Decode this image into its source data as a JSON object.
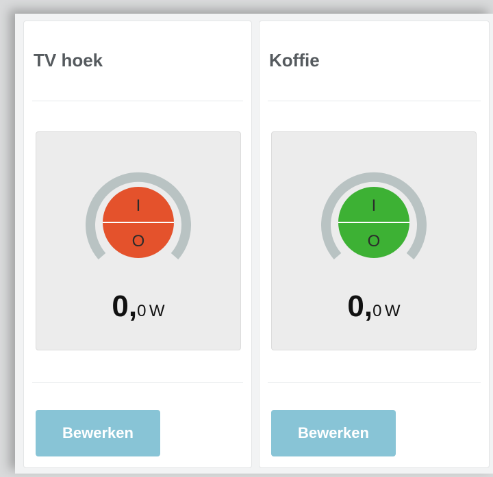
{
  "devices": [
    {
      "name": "TV hoek",
      "state_color": "#e4522c",
      "switch_on_symbol": "I",
      "switch_off_symbol": "O",
      "power_integer": "0,",
      "power_decimal": "0",
      "power_unit": "W",
      "edit_label": "Bewerken"
    },
    {
      "name": "Koffie",
      "state_color": "#3db134",
      "switch_on_symbol": "I",
      "switch_off_symbol": "O",
      "power_integer": "0,",
      "power_decimal": "0",
      "power_unit": "W",
      "edit_label": "Bewerken"
    }
  ],
  "colors": {
    "gauge_track": "#b9c3c3",
    "button_bg": "#88c4d6",
    "panel_bg": "#ececec"
  },
  "icons": [
    "power-toggle-icon"
  ]
}
